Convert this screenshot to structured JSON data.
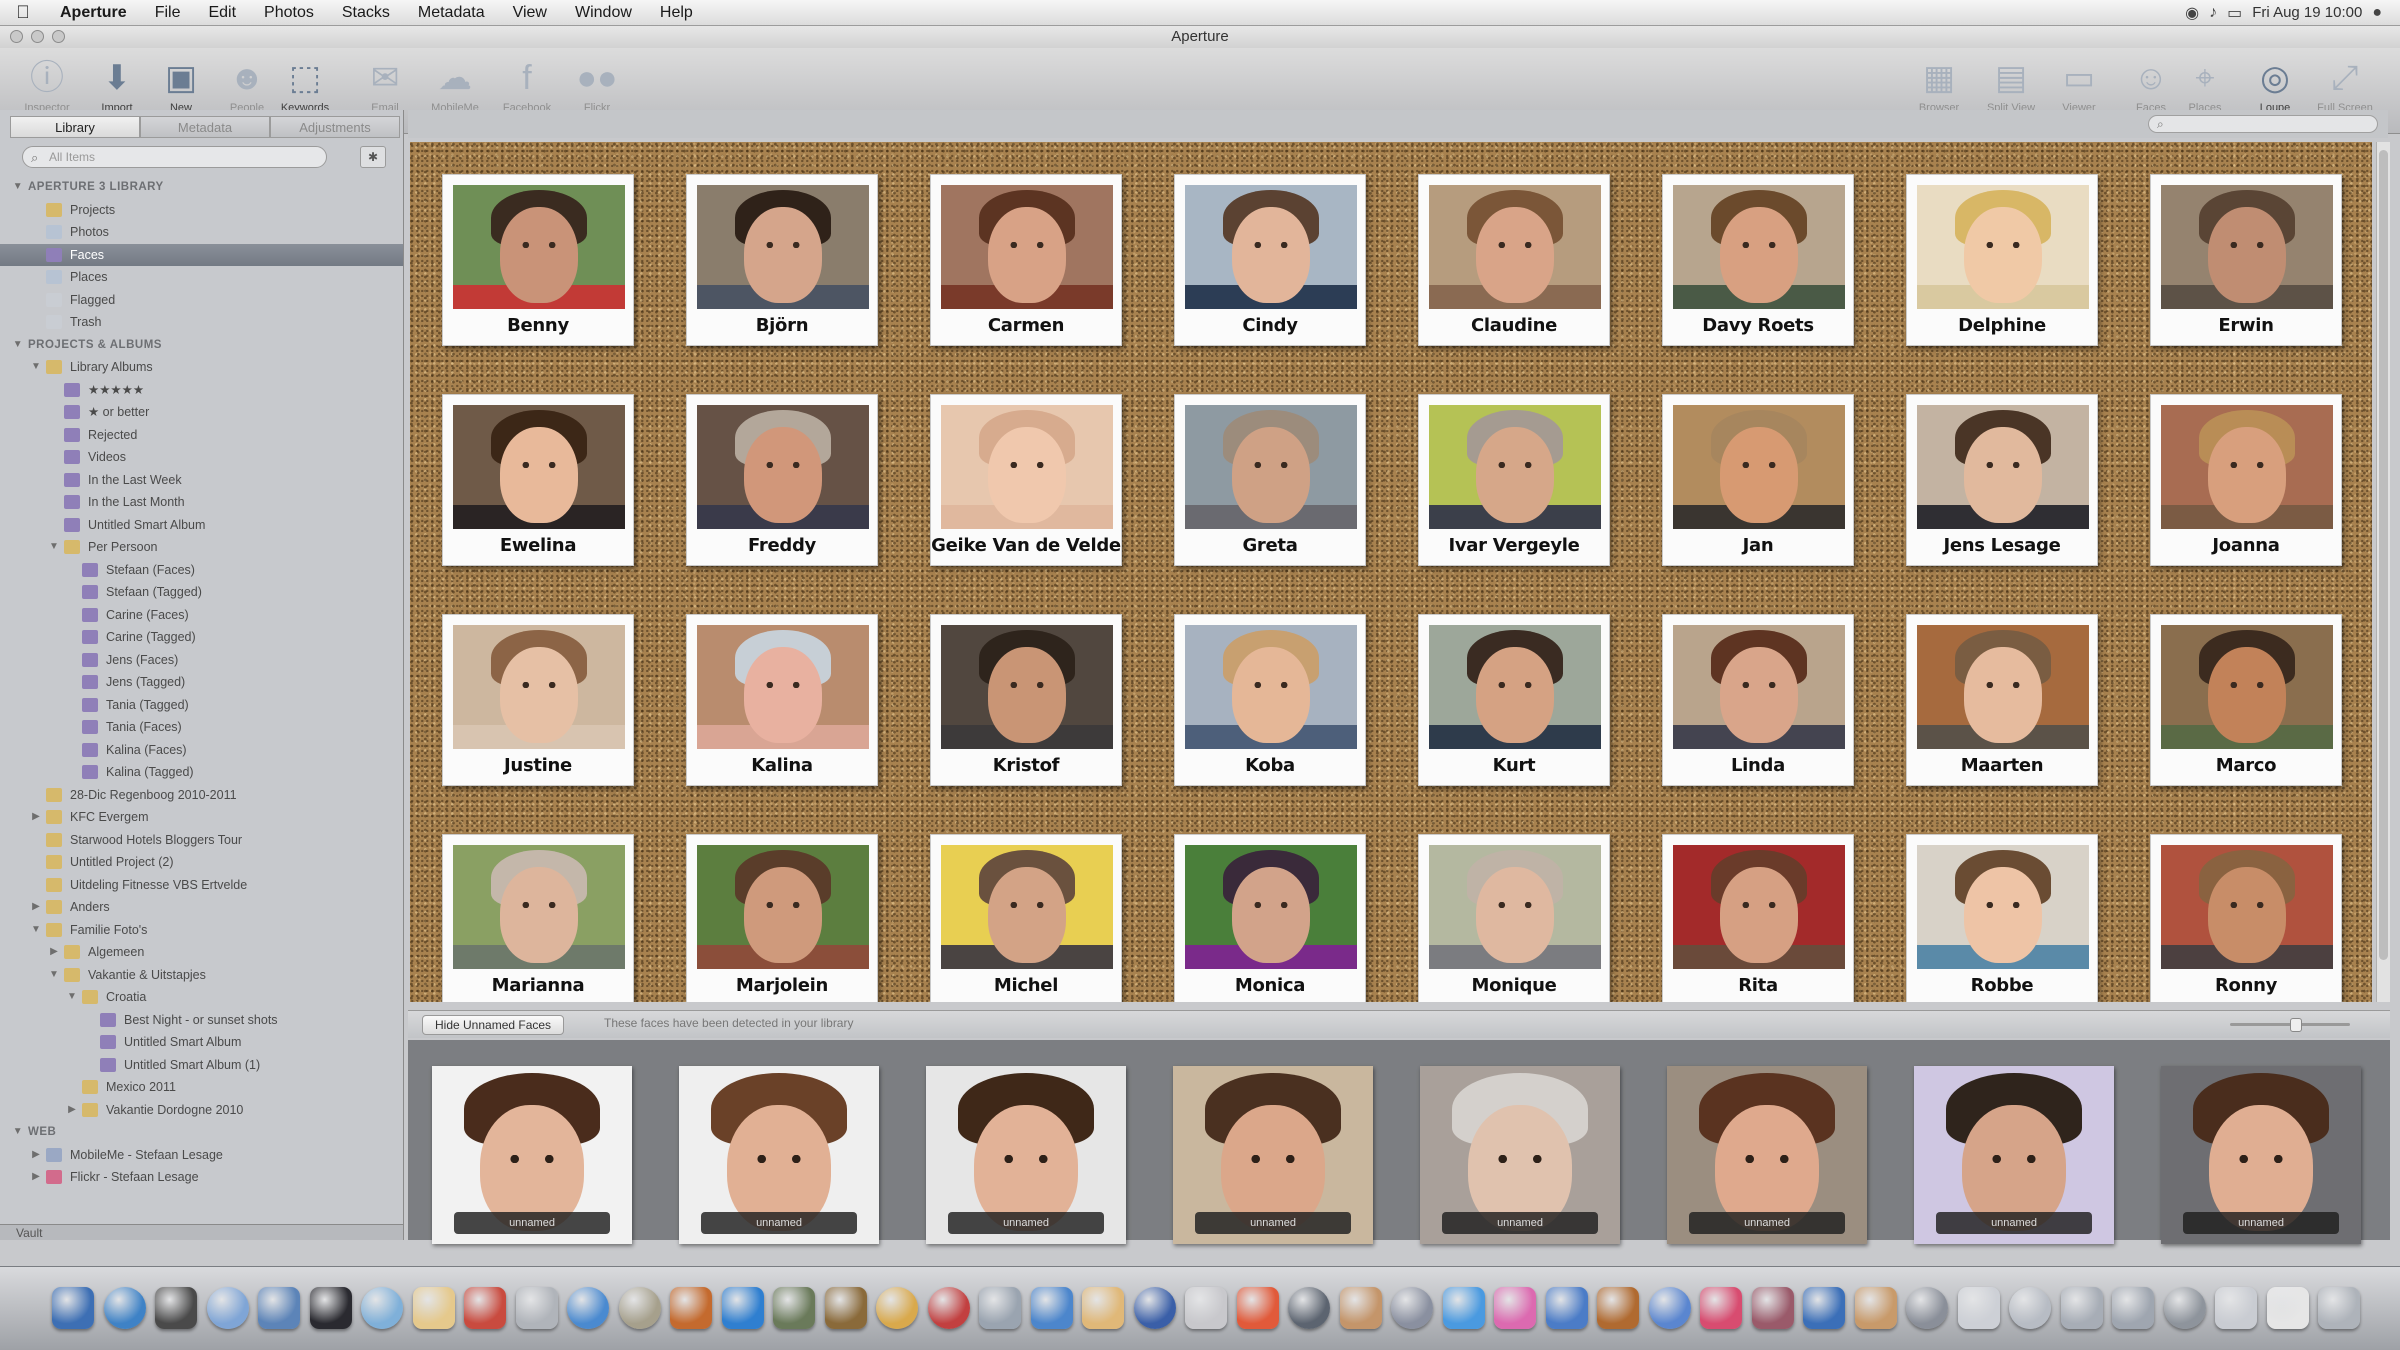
{
  "menubar": {
    "app": "Aperture",
    "menus": [
      "File",
      "Edit",
      "Photos",
      "Stacks",
      "Metadata",
      "View",
      "Window",
      "Help"
    ],
    "clock": "Fri Aug 19  10:00"
  },
  "window": {
    "title": "Aperture"
  },
  "toolbar": {
    "left": [
      {
        "name": "inspector",
        "label": "Inspector",
        "icon": "info-icon",
        "dim": true
      },
      {
        "name": "import",
        "label": "Import",
        "icon": "import-icon",
        "dim": false
      },
      {
        "name": "new",
        "label": "New",
        "icon": "new-folder-icon",
        "dim": false
      },
      {
        "name": "loupe-person",
        "label": "People",
        "icon": "people-icon",
        "dim": true
      },
      {
        "name": "keywords",
        "label": "Keywords",
        "icon": "tag-icon",
        "dim": false
      },
      {
        "name": "email",
        "label": "Email",
        "icon": "email-icon",
        "dim": true
      },
      {
        "name": "mobileme",
        "label": "MobileMe",
        "icon": "cloud-icon",
        "dim": true
      },
      {
        "name": "facebook",
        "label": "Facebook",
        "icon": "facebook-icon",
        "dim": true
      },
      {
        "name": "flickr",
        "label": "Flickr",
        "icon": "flickr-icon",
        "dim": true
      }
    ],
    "right": [
      {
        "name": "browser",
        "label": "Browser",
        "icon": "browser-icon",
        "dim": true
      },
      {
        "name": "split-view",
        "label": "Split View",
        "icon": "split-view-icon",
        "dim": true
      },
      {
        "name": "viewer",
        "label": "Viewer",
        "icon": "viewer-icon",
        "dim": true
      },
      {
        "name": "faces",
        "label": "Faces",
        "icon": "faces-icon",
        "dim": true
      },
      {
        "name": "places",
        "label": "Places",
        "icon": "places-icon",
        "dim": true
      },
      {
        "name": "loupe",
        "label": "Loupe",
        "icon": "loupe-icon",
        "dim": false
      },
      {
        "name": "full-screen",
        "label": "Full Screen",
        "icon": "full-screen-icon",
        "dim": true
      }
    ]
  },
  "sidebar": {
    "tabs": [
      "Library",
      "Metadata",
      "Adjustments"
    ],
    "search_placeholder": "All Items",
    "footer": "Vault",
    "items": [
      {
        "label": "APERTURE 3 LIBRARY",
        "type": "header",
        "level": 0,
        "tri": "▼"
      },
      {
        "label": "Projects",
        "level": 1,
        "icon": "#d6b96b"
      },
      {
        "label": "Photos",
        "level": 1,
        "icon": "#b7c3d3"
      },
      {
        "label": "Faces",
        "level": 1,
        "icon": "#8f7fb8",
        "selected": true
      },
      {
        "label": "Places",
        "level": 1,
        "icon": "#b7c3d3"
      },
      {
        "label": "Flagged",
        "level": 1,
        "icon": "#c9cdd3"
      },
      {
        "label": "Trash",
        "level": 1,
        "icon": "#c9cdd3"
      },
      {
        "label": "PROJECTS & ALBUMS",
        "type": "header",
        "level": 0,
        "tri": "▼"
      },
      {
        "label": "Library Albums",
        "level": 1,
        "icon": "#d6b96b",
        "tri": "▼"
      },
      {
        "label": "★★★★★",
        "level": 2,
        "icon": "#8f7fb8"
      },
      {
        "label": "★ or better",
        "level": 2,
        "icon": "#8f7fb8"
      },
      {
        "label": "Rejected",
        "level": 2,
        "icon": "#8f7fb8"
      },
      {
        "label": "Videos",
        "level": 2,
        "icon": "#8f7fb8"
      },
      {
        "label": "In the Last Week",
        "level": 2,
        "icon": "#8f7fb8"
      },
      {
        "label": "In the Last Month",
        "level": 2,
        "icon": "#8f7fb8"
      },
      {
        "label": "Untitled Smart Album",
        "level": 2,
        "icon": "#8f7fb8"
      },
      {
        "label": "Per Persoon",
        "level": 2,
        "icon": "#d6b96b",
        "tri": "▼"
      },
      {
        "label": "Stefaan (Faces)",
        "level": 3,
        "icon": "#8f7fb8"
      },
      {
        "label": "Stefaan (Tagged)",
        "level": 3,
        "icon": "#8f7fb8"
      },
      {
        "label": "Carine (Faces)",
        "level": 3,
        "icon": "#8f7fb8"
      },
      {
        "label": "Carine (Tagged)",
        "level": 3,
        "icon": "#8f7fb8"
      },
      {
        "label": "Jens (Faces)",
        "level": 3,
        "icon": "#8f7fb8"
      },
      {
        "label": "Jens (Tagged)",
        "level": 3,
        "icon": "#8f7fb8"
      },
      {
        "label": "Tania (Tagged)",
        "level": 3,
        "icon": "#8f7fb8"
      },
      {
        "label": "Tania (Faces)",
        "level": 3,
        "icon": "#8f7fb8"
      },
      {
        "label": "Kalina (Faces)",
        "level": 3,
        "icon": "#8f7fb8"
      },
      {
        "label": "Kalina (Tagged)",
        "level": 3,
        "icon": "#8f7fb8"
      },
      {
        "label": "28-Dic Regenboog 2010-2011",
        "level": 1,
        "icon": "#d6b96b"
      },
      {
        "label": "KFC Evergem",
        "level": 1,
        "icon": "#d6b96b",
        "tri": "▶"
      },
      {
        "label": "Starwood Hotels Bloggers Tour",
        "level": 1,
        "icon": "#d6b96b"
      },
      {
        "label": "Untitled Project (2)",
        "level": 1,
        "icon": "#d6b96b"
      },
      {
        "label": "Uitdeling Fitnesse VBS Ertvelde",
        "level": 1,
        "icon": "#d6b96b"
      },
      {
        "label": "Anders",
        "level": 1,
        "icon": "#d6b96b",
        "tri": "▶"
      },
      {
        "label": "Familie Foto's",
        "level": 1,
        "icon": "#d6b96b",
        "tri": "▼"
      },
      {
        "label": "Algemeen",
        "level": 2,
        "icon": "#d6b96b",
        "tri": "▶"
      },
      {
        "label": "Vakantie & Uitstapjes",
        "level": 2,
        "icon": "#d6b96b",
        "tri": "▼"
      },
      {
        "label": "Croatia",
        "level": 3,
        "icon": "#d6b96b",
        "tri": "▼"
      },
      {
        "label": "Best Night - or sunset shots",
        "level": 4,
        "icon": "#8f7fb8"
      },
      {
        "label": "Untitled Smart Album",
        "level": 4,
        "icon": "#8f7fb8"
      },
      {
        "label": "Untitled Smart Album (1)",
        "level": 4,
        "icon": "#8f7fb8"
      },
      {
        "label": "Mexico 2011",
        "level": 3,
        "icon": "#d6b96b"
      },
      {
        "label": "Vakantie Dordogne 2010",
        "level": 3,
        "icon": "#d6b96b",
        "tri": "▶"
      },
      {
        "label": "WEB",
        "type": "header",
        "level": 0,
        "tri": "▼"
      },
      {
        "label": "MobileMe - Stefaan Lesage",
        "level": 1,
        "icon": "#9aa8c4",
        "tri": "▶"
      },
      {
        "label": "Flickr - Stefaan Lesage",
        "level": 1,
        "icon": "#d26b8c",
        "tri": "▶"
      }
    ]
  },
  "browser": {
    "search_placeholder": "",
    "faces": [
      {
        "name": "Benny",
        "skin": "#c99378",
        "hair": "#3a2b20",
        "bg": "#6f8f56",
        "shirt": "#c23a36"
      },
      {
        "name": "Björn",
        "skin": "#d5a58b",
        "hair": "#2f2219",
        "bg": "#8a7d6c",
        "shirt": "#4d5563"
      },
      {
        "name": "Carmen",
        "skin": "#d8a286",
        "hair": "#5c3422",
        "bg": "#a07560",
        "shirt": "#7a3a2a"
      },
      {
        "name": "Cindy",
        "skin": "#e2b59a",
        "hair": "#5b4232",
        "bg": "#a8b6c4",
        "shirt": "#2c3d55"
      },
      {
        "name": "Claudine",
        "skin": "#d9a488",
        "hair": "#7b5638",
        "bg": "#b69c7e",
        "shirt": "#8a6a52"
      },
      {
        "name": "Davy Roets",
        "skin": "#d8a081",
        "hair": "#6b4a2c",
        "bg": "#b7a58e",
        "shirt": "#4a5a46"
      },
      {
        "name": "Delphine",
        "skin": "#f0c9a6",
        "hair": "#d8b766",
        "bg": "#e9dcc2",
        "shirt": "#d9c9a0"
      },
      {
        "name": "Erwin",
        "skin": "#c08d72",
        "hair": "#5a4535",
        "bg": "#95836f",
        "shirt": "#5d5247"
      },
      {
        "name": "Ewelina",
        "skin": "#e8b99a",
        "hair": "#3c2717",
        "bg": "#6f5a48",
        "shirt": "#2a2424"
      },
      {
        "name": "Freddy",
        "skin": "#d1977a",
        "hair": "#b3a79a",
        "bg": "#665246",
        "shirt": "#3a3a4a"
      },
      {
        "name": "Geike Van de Velde",
        "skin": "#f0c8ad",
        "hair": "#d7ab8e",
        "bg": "#e7c7ae",
        "shirt": "#e0b89e"
      },
      {
        "name": "Greta",
        "skin": "#cfa185",
        "hair": "#9c8c7c",
        "bg": "#8e9aa2",
        "shirt": "#6a6a70"
      },
      {
        "name": "Ivar Vergeyle",
        "skin": "#d6a789",
        "hair": "#a59b91",
        "bg": "#b5c255",
        "shirt": "#3b3f4a"
      },
      {
        "name": "Jan",
        "skin": "#d79a72",
        "hair": "#a7865e",
        "bg": "#b28c5e",
        "shirt": "#3a3530"
      },
      {
        "name": "Jens Lesage",
        "skin": "#e1b99d",
        "hair": "#4a3526",
        "bg": "#c3b3a2",
        "shirt": "#2f2e33"
      },
      {
        "name": "Joanna",
        "skin": "#d89f7d",
        "hair": "#b98d56",
        "bg": "#a86c52",
        "shirt": "#7b5b44"
      },
      {
        "name": "Justine",
        "skin": "#e6c0a5",
        "hair": "#8c6446",
        "bg": "#cdb79f",
        "shirt": "#d8c4b0"
      },
      {
        "name": "Kalina",
        "skin": "#e8b1a0",
        "hair": "#c7cfd6",
        "bg": "#b98c6e",
        "shirt": "#d9a594"
      },
      {
        "name": "Kristof",
        "skin": "#c99575",
        "hair": "#2e241c",
        "bg": "#51473f",
        "shirt": "#3d3a3a"
      },
      {
        "name": "Koba",
        "skin": "#e5b797",
        "hair": "#c8a070",
        "bg": "#a7b2c0",
        "shirt": "#4d5f7a"
      },
      {
        "name": "Kurt",
        "skin": "#d5a283",
        "hair": "#3a2b22",
        "bg": "#9da79a",
        "shirt": "#2e3b4b"
      },
      {
        "name": "Linda",
        "skin": "#d9a58a",
        "hair": "#5e3422",
        "bg": "#b9a48c",
        "shirt": "#444450"
      },
      {
        "name": "Maarten",
        "skin": "#e6bb9e",
        "hair": "#7a5d42",
        "bg": "#a66a3e",
        "shirt": "#5b5248"
      },
      {
        "name": "Marco",
        "skin": "#c28259",
        "hair": "#3c2b1f",
        "bg": "#8a6e4e",
        "shirt": "#5a6a45"
      },
      {
        "name": "Marianna",
        "skin": "#ddb59c",
        "hair": "#c4b7aa",
        "bg": "#8aa063",
        "shirt": "#6e7a6a"
      },
      {
        "name": "Marjolein",
        "skin": "#cf9a7c",
        "hair": "#5a3d2a",
        "bg": "#5c7e3f",
        "shirt": "#8b4e3a"
      },
      {
        "name": "Michel",
        "skin": "#d3a386",
        "hair": "#6a513e",
        "bg": "#e8cf52",
        "shirt": "#4a4442"
      },
      {
        "name": "Monica",
        "skin": "#d2a38a",
        "hair": "#3a2a3a",
        "bg": "#4a7f3a",
        "shirt": "#7a2a8a"
      },
      {
        "name": "Monique",
        "skin": "#dfb8a0",
        "hair": "#bfb3a6",
        "bg": "#b4b8a0",
        "shirt": "#7b7c80"
      },
      {
        "name": "Rita",
        "skin": "#d6a083",
        "hair": "#6a3b2a",
        "bg": "#a32a2a",
        "shirt": "#6a4a3a"
      },
      {
        "name": "Robbe",
        "skin": "#eec4a6",
        "hair": "#6a4c33",
        "bg": "#d8d2c8",
        "shirt": "#5a8aa8"
      },
      {
        "name": "Ronny",
        "skin": "#c88d68",
        "hair": "#8a6240",
        "bg": "#b0523e",
        "shirt": "#4c4040"
      }
    ]
  },
  "unnamed": {
    "button_label": "Hide Unnamed Faces",
    "hint": "These faces have been detected in your library",
    "tag_label": "unnamed",
    "faces": [
      {
        "skin": "#e3b59a",
        "hair": "#4a2c1c",
        "bg": "#f2f2f2"
      },
      {
        "skin": "#e1b094",
        "hair": "#6a4128",
        "bg": "#efefef"
      },
      {
        "skin": "#e2b297",
        "hair": "#3f2818",
        "bg": "#e6e6e6"
      },
      {
        "skin": "#dba78a",
        "hair": "#4a3020",
        "bg": "#c9b79e"
      },
      {
        "skin": "#e0c2ae",
        "hair": "#d4d0cc",
        "bg": "#a9a09a"
      },
      {
        "skin": "#dfa98d",
        "hair": "#5a3320",
        "bg": "#9b8e80"
      },
      {
        "skin": "#d6a489",
        "hair": "#2f241c",
        "bg": "#cfc7e2"
      },
      {
        "skin": "#e0ae92",
        "hair": "#4a2d1d",
        "bg": "#6e6e72"
      }
    ]
  },
  "dock": {
    "colors": [
      "#3d6fb4",
      "#3e82c6",
      "#4a4a4a",
      "#7fa5d6",
      "#5c84b8",
      "#2a2a30",
      "#7fb0d9",
      "#e5c98c",
      "#c94b3f",
      "#b0b4ba",
      "#4a8ad0",
      "#a6a08c",
      "#c46a2e",
      "#2f7fd0",
      "#6a7a5a",
      "#8a6a3a",
      "#d9a94c",
      "#c24040",
      "#9aa4b0",
      "#4c86cc",
      "#e0b878",
      "#3a5fa8",
      "#c8c8cc",
      "#e15a3a",
      "#5c6470",
      "#c4956a",
      "#8a90a0",
      "#4a9ae0",
      "#dc6ab0",
      "#4b7cc7",
      "#b06a30",
      "#5a86d0",
      "#d84c70",
      "#9a5a6a",
      "#3b6fb8",
      "#c89a6a",
      "#8a8f99",
      "#cdd0d6",
      "#b7bcc4",
      "#a7adb6",
      "#9fa6b0",
      "#8e949c",
      "#c9ccd2",
      "#e6e6e6",
      "#aeb3ba"
    ]
  }
}
